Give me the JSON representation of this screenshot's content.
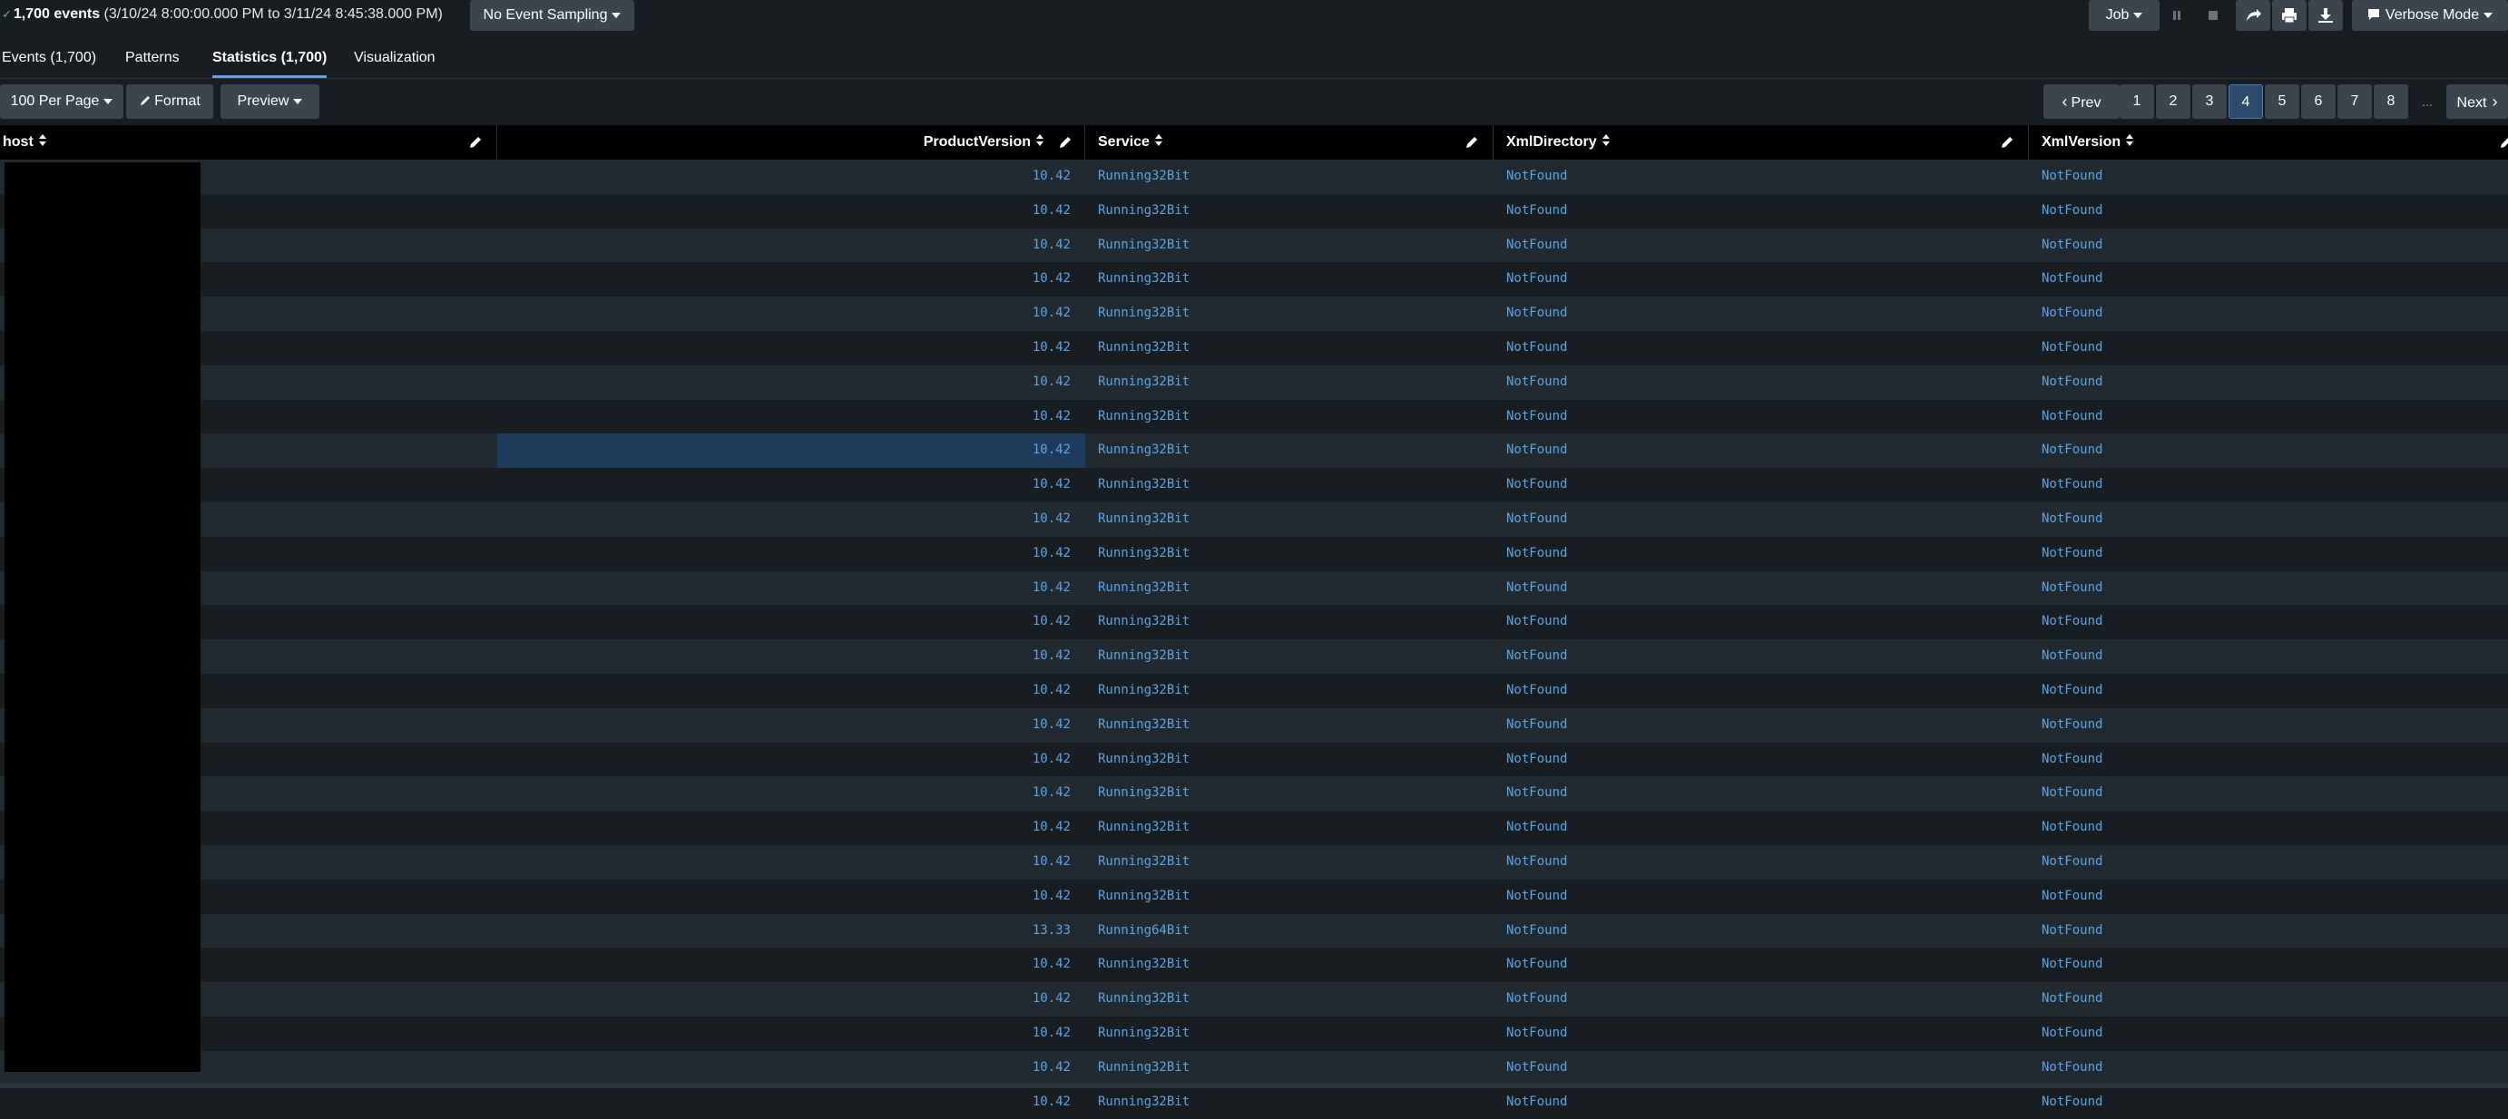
{
  "summary": {
    "check": "✓",
    "event_count": "1,700 events",
    "time_range": "(3/10/24 8:00:00.000 PM to 3/11/24 8:45:38.000 PM)"
  },
  "sampling_button": "No Event Sampling",
  "job_button": "Job",
  "mode_button": "Verbose Mode",
  "tabs": [
    "Events (1,700)",
    "Patterns",
    "Statistics (1,700)",
    "Visualization"
  ],
  "toolbar": {
    "per_page": "100 Per Page",
    "format": "Format",
    "preview": "Preview"
  },
  "pagination": {
    "prev": "Prev",
    "pages": [
      "1",
      "2",
      "3",
      "4",
      "5",
      "6",
      "7",
      "8"
    ],
    "current": "4",
    "ellipsis": "...",
    "next": "Next"
  },
  "columns": [
    "host",
    "ProductVersion",
    "Service",
    "XmlDirectory",
    "XmlVersion"
  ],
  "rows": [
    {
      "product_version": "10.42",
      "service": "Running32Bit",
      "xml_directory": "NotFound",
      "xml_version": "NotFound"
    },
    {
      "product_version": "10.42",
      "service": "Running32Bit",
      "xml_directory": "NotFound",
      "xml_version": "NotFound"
    },
    {
      "product_version": "10.42",
      "service": "Running32Bit",
      "xml_directory": "NotFound",
      "xml_version": "NotFound"
    },
    {
      "product_version": "10.42",
      "service": "Running32Bit",
      "xml_directory": "NotFound",
      "xml_version": "NotFound"
    },
    {
      "product_version": "10.42",
      "service": "Running32Bit",
      "xml_directory": "NotFound",
      "xml_version": "NotFound"
    },
    {
      "product_version": "10.42",
      "service": "Running32Bit",
      "xml_directory": "NotFound",
      "xml_version": "NotFound"
    },
    {
      "product_version": "10.42",
      "service": "Running32Bit",
      "xml_directory": "NotFound",
      "xml_version": "NotFound"
    },
    {
      "product_version": "10.42",
      "service": "Running32Bit",
      "xml_directory": "NotFound",
      "xml_version": "NotFound"
    },
    {
      "product_version": "10.42",
      "service": "Running32Bit",
      "xml_directory": "NotFound",
      "xml_version": "NotFound"
    },
    {
      "product_version": "10.42",
      "service": "Running32Bit",
      "xml_directory": "NotFound",
      "xml_version": "NotFound"
    },
    {
      "product_version": "10.42",
      "service": "Running32Bit",
      "xml_directory": "NotFound",
      "xml_version": "NotFound"
    },
    {
      "product_version": "10.42",
      "service": "Running32Bit",
      "xml_directory": "NotFound",
      "xml_version": "NotFound"
    },
    {
      "product_version": "10.42",
      "service": "Running32Bit",
      "xml_directory": "NotFound",
      "xml_version": "NotFound"
    },
    {
      "product_version": "10.42",
      "service": "Running32Bit",
      "xml_directory": "NotFound",
      "xml_version": "NotFound"
    },
    {
      "product_version": "10.42",
      "service": "Running32Bit",
      "xml_directory": "NotFound",
      "xml_version": "NotFound"
    },
    {
      "product_version": "10.42",
      "service": "Running32Bit",
      "xml_directory": "NotFound",
      "xml_version": "NotFound"
    },
    {
      "product_version": "10.42",
      "service": "Running32Bit",
      "xml_directory": "NotFound",
      "xml_version": "NotFound"
    },
    {
      "product_version": "10.42",
      "service": "Running32Bit",
      "xml_directory": "NotFound",
      "xml_version": "NotFound"
    },
    {
      "product_version": "10.42",
      "service": "Running32Bit",
      "xml_directory": "NotFound",
      "xml_version": "NotFound"
    },
    {
      "product_version": "10.42",
      "service": "Running32Bit",
      "xml_directory": "NotFound",
      "xml_version": "NotFound"
    },
    {
      "product_version": "10.42",
      "service": "Running32Bit",
      "xml_directory": "NotFound",
      "xml_version": "NotFound"
    },
    {
      "product_version": "10.42",
      "service": "Running32Bit",
      "xml_directory": "NotFound",
      "xml_version": "NotFound"
    },
    {
      "product_version": "13.33",
      "service": "Running64Bit",
      "xml_directory": "NotFound",
      "xml_version": "NotFound"
    },
    {
      "product_version": "10.42",
      "service": "Running32Bit",
      "xml_directory": "NotFound",
      "xml_version": "NotFound"
    },
    {
      "product_version": "10.42",
      "service": "Running32Bit",
      "xml_directory": "NotFound",
      "xml_version": "NotFound"
    },
    {
      "product_version": "10.42",
      "service": "Running32Bit",
      "xml_directory": "NotFound",
      "xml_version": "NotFound"
    },
    {
      "product_version": "10.42",
      "service": "Running32Bit",
      "xml_directory": "NotFound",
      "xml_version": "NotFound"
    },
    {
      "product_version": "10.42",
      "service": "Running32Bit",
      "xml_directory": "NotFound",
      "xml_version": "NotFound"
    }
  ],
  "highlighted_row": 8,
  "colors": {
    "background": "#171d21",
    "row_alt": "#212a30",
    "header_bg": "#000000",
    "link": "#5ba4e6",
    "button": "#3c444d",
    "highlight": "#1e3c5a"
  },
  "icons": {
    "pause": "pause-icon",
    "stop": "stop-icon",
    "share": "share-icon",
    "print": "print-icon",
    "export": "download-icon",
    "mode": "message-icon",
    "format": "pencil-icon",
    "column_edit": "pencil-icon",
    "sort": "sort-icon"
  }
}
